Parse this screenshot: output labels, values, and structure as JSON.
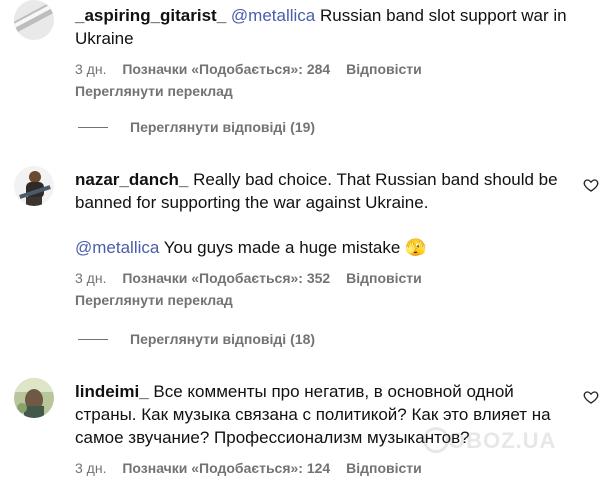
{
  "comments": [
    {
      "username": "_aspiring_gitarist_",
      "mention": "@metallica",
      "text": " Russian band slot support war in Ukraine",
      "time": "3 дн.",
      "likes": "Позначки «Подобається»: 284",
      "reply": "Відповісти",
      "translate": "Переглянути переклад",
      "view_replies": "Переглянути відповіді",
      "replies_count": "(19)"
    },
    {
      "username": "nazar_danch_",
      "text": " Really bad choice. That Russian band should be banned for supporting the war against Ukraine.",
      "mention": "@metallica",
      "text2": " You guys made a huge mistake 🫣",
      "time": "3 дн.",
      "likes": "Позначки «Подобається»: 352",
      "reply": "Відповісти",
      "translate": "Переглянути переклад",
      "view_replies": "Переглянути відповіді",
      "replies_count": "(18)"
    },
    {
      "username": "lindeimi_",
      "text": " Все комменты про негатив, в основной одной страны. Как музыка связана с политикой? Как это влияет на самое звучание? Профессионализм музыкантов?",
      "time": "3 дн.",
      "likes": "Позначки «Подобається»: 124",
      "reply": "Відповісти"
    }
  ],
  "watermark": "OBOZ.UA",
  "icons": {
    "like": "heart-outline-icon"
  }
}
